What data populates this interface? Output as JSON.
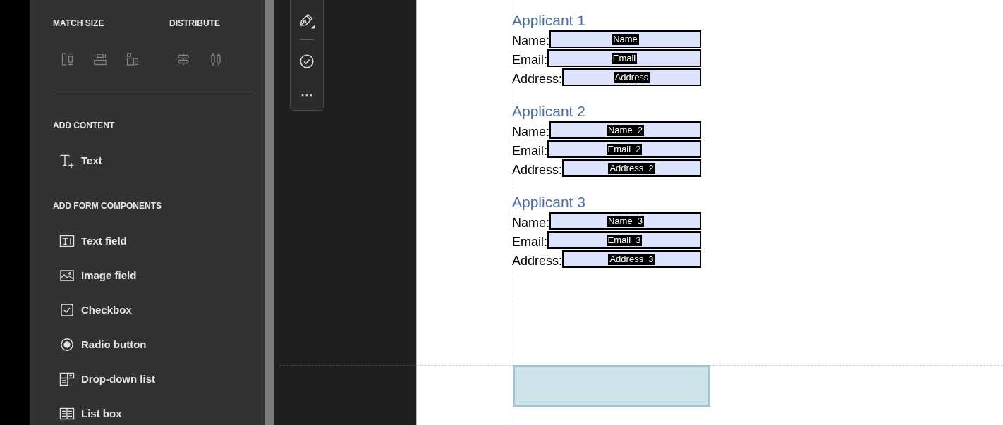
{
  "sidebar": {
    "match_size": {
      "title": "MATCH SIZE",
      "tools": [
        {
          "kind": "width",
          "disabled": true
        },
        {
          "kind": "height",
          "disabled": true
        },
        {
          "kind": "both",
          "disabled": true
        }
      ]
    },
    "distribute": {
      "title": "DISTRIBUTE",
      "tools": [
        {
          "kind": "vertical",
          "disabled": true
        },
        {
          "kind": "horizontal",
          "disabled": true
        }
      ]
    },
    "add_content": {
      "title": "ADD CONTENT",
      "items": [
        {
          "kind": "text",
          "label": "Text"
        }
      ]
    },
    "add_form_components": {
      "title": "ADD FORM COMPONENTS",
      "items": [
        {
          "kind": "textfield",
          "label": "Text field"
        },
        {
          "kind": "image",
          "label": "Image field"
        },
        {
          "kind": "checkbox",
          "label": "Checkbox"
        },
        {
          "kind": "radio",
          "label": "Radio button"
        },
        {
          "kind": "dropdown",
          "label": "Drop-down list"
        },
        {
          "kind": "listbox",
          "label": "List box"
        }
      ]
    }
  },
  "form": {
    "sections": [
      {
        "heading": "Applicant 1",
        "fields": [
          {
            "label": "Name:",
            "field_name": "Name"
          },
          {
            "label": "Email:",
            "field_name": "Email"
          },
          {
            "label": "Address:",
            "field_name": "Address"
          }
        ]
      },
      {
        "heading": "Applicant 2",
        "fields": [
          {
            "label": "Name:",
            "field_name": "Name_2"
          },
          {
            "label": "Email:",
            "field_name": "Email_2"
          },
          {
            "label": "Address:",
            "field_name": "Address_2"
          }
        ]
      },
      {
        "heading": "Applicant 3",
        "fields": [
          {
            "label": "Name:",
            "field_name": "Name_3"
          },
          {
            "label": "Email:",
            "field_name": "Email_3"
          },
          {
            "label": "Address:",
            "field_name": "Address_3"
          }
        ]
      }
    ]
  }
}
